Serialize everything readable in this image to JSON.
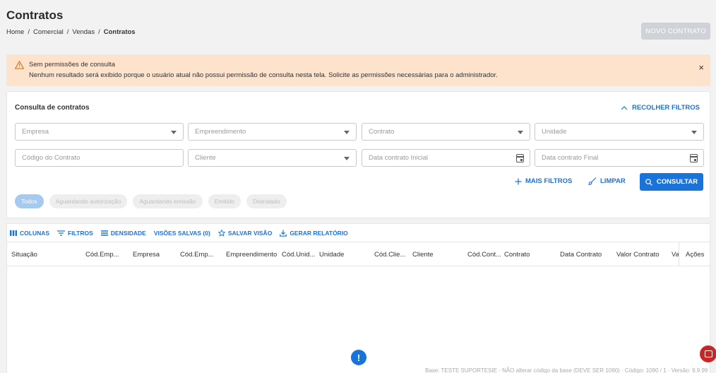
{
  "header": {
    "title": "Contratos",
    "breadcrumb": [
      "Home",
      "/",
      "Comercial",
      "/",
      "Vendas",
      "/",
      "Contratos"
    ],
    "new_button": "NOVO CONTRATO"
  },
  "alert": {
    "title": "Sem permissões de consulta",
    "message": "Nenhum resultado será exibido porque o usuário atual não possui permissão de consulta nesta tela. Solicite as permissões necessárias para o administrador.",
    "close": "×"
  },
  "filters": {
    "title": "Consulta de contratos",
    "collapse_label": "RECOLHER FILTROS",
    "fields": {
      "empresa": "Empresa",
      "empreendimento": "Empreendimento",
      "contrato": "Contrato",
      "unidade": "Unidade",
      "codigo_contrato": "Código do Contrato",
      "cliente": "Cliente",
      "data_inicial": "Data contrato Inicial",
      "data_final": "Data contrato Final"
    },
    "more_filters": "MAIS FILTROS",
    "clear": "LIMPAR",
    "consult": "CONSULTAR",
    "status_chips": [
      "Todos",
      "Aguardando autorização",
      "Aguardando emissão",
      "Emitido",
      "Distratado"
    ]
  },
  "grid": {
    "toolbar": [
      "COLUNAS",
      "FILTROS",
      "DENSIDADE",
      "VISÕES SALVAS (0)",
      "SALVAR VISÃO",
      "GERAR RELATÓRIO"
    ],
    "columns": [
      "Situação",
      "Cód.Emp...",
      "Empresa",
      "Cód.Emp...",
      "Empreendimento",
      "Cód.Unid...",
      "Unidade",
      "Cód.Clie...",
      "Cliente",
      "Cód.Cont...",
      "Contrato",
      "Data Contrato",
      "Valor Contrato",
      "Va",
      "Ações"
    ]
  },
  "fab": {
    "info": "!"
  },
  "footer": "Base: TESTE SUPORTESIE - NÃO alterar código da base (DEVE SER 1090) · Código: 1090 / 1 · Versão: 9.9.99",
  "colors": {
    "accent": "#1a73d9",
    "alert_bg": "#fde2cc",
    "disabled_btn": "#cfd3d8"
  }
}
